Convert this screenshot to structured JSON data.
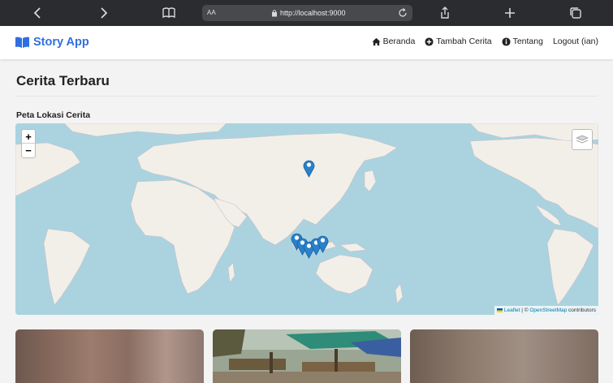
{
  "browser": {
    "url": "http://localhost:9000",
    "text_size_label": "AA"
  },
  "header": {
    "app_name": "Story App",
    "nav": [
      {
        "label": "Beranda",
        "icon": "home-icon"
      },
      {
        "label": "Tambah Cerita",
        "icon": "plus-circle-icon"
      },
      {
        "label": "Tentang",
        "icon": "info-icon"
      },
      {
        "label": "Logout (ian)",
        "icon": ""
      }
    ]
  },
  "main": {
    "title": "Cerita Terbaru",
    "map_label": "Peta Lokasi Cerita",
    "zoom_in": "+",
    "zoom_out": "−",
    "attribution": {
      "leaflet": "Leaflet",
      "separator": " | © ",
      "osm": "OpenStreetMap",
      "suffix": " contributors"
    }
  },
  "colors": {
    "accent": "#2f6fdf",
    "water": "#aad3df",
    "land": "#f2efe9",
    "marker": "#2a81cb"
  }
}
